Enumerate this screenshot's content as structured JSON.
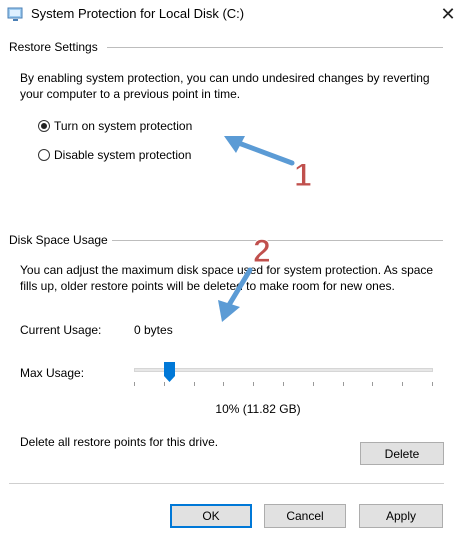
{
  "window": {
    "title": "System Protection for Local Disk (C:)"
  },
  "restore_settings": {
    "heading": "Restore Settings",
    "description": "By enabling system protection, you can undo undesired changes by reverting your computer to a previous point in time.",
    "option_on": "Turn on system protection",
    "option_off": "Disable system protection",
    "selected": "option_on"
  },
  "disk_space": {
    "heading": "Disk Space Usage",
    "description": "You can adjust the maximum disk space used for system protection. As space fills up, older restore points will be deleted to make room for new ones.",
    "current_usage_label": "Current Usage:",
    "current_usage_value": "0 bytes",
    "max_usage_label": "Max Usage:",
    "max_usage_value": "10% (11.82 GB)",
    "max_usage_fraction": 0.1,
    "delete_text": "Delete all restore points for this drive.",
    "delete_button": "Delete"
  },
  "buttons": {
    "ok": "OK",
    "cancel": "Cancel",
    "apply": "Apply"
  },
  "annotations": {
    "marker_1": "1",
    "marker_2": "2",
    "arrow_color": "#5b9bd5",
    "number_color": "#c0504d"
  }
}
